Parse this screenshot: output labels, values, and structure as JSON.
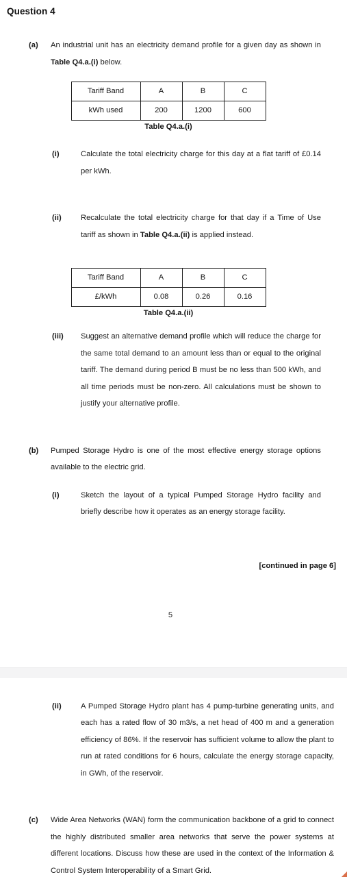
{
  "document": {
    "title": "Question 4",
    "page_number": "5",
    "continued_note": "[continued in page 6]"
  },
  "parts": {
    "a": {
      "marker": "(a)",
      "intro_prefix": "An industrial unit has an electricity demand profile for a given day as shown in ",
      "intro_bold": "Table Q4.a.(i)",
      "intro_suffix": " below.",
      "sub": {
        "i": {
          "marker": "(i)",
          "text": "Calculate the total electricity charge for this day at a flat tariff of £0.14 per kWh."
        },
        "ii": {
          "marker": "(ii)",
          "text_prefix": "Recalculate the total electricity charge for that day if a Time of Use tariff as shown in ",
          "text_bold": "Table Q4.a.(ii)",
          "text_suffix": " is applied instead."
        },
        "iii": {
          "marker": "(iii)",
          "text": "Suggest an alternative demand profile which will reduce the charge for the same total demand to an amount less than or equal to the original tariff. The demand during period B must be no less than 500 kWh, and all time periods must be non-zero. All calculations must be shown to justify your alternative profile."
        }
      }
    },
    "b": {
      "marker": "(b)",
      "intro": "Pumped Storage Hydro is one of the most effective energy storage options available to the electric grid.",
      "sub": {
        "i": {
          "marker": "(i)",
          "text": "Sketch the layout of a typical Pumped Storage Hydro facility and briefly describe how it operates as an energy storage facility."
        },
        "ii": {
          "marker": "(ii)",
          "text": "A Pumped Storage Hydro plant has 4 pump-turbine generating units, and each has a rated flow of 30 m3/s, a net head of 400 m and a generation efficiency of 86%.  If the reservoir has sufficient volume to allow the plant to run at rated conditions for 6 hours, calculate the energy storage capacity, in GWh, of the reservoir."
        }
      }
    },
    "c": {
      "marker": "(c)",
      "text": "Wide Area Networks (WAN) form the communication backbone of a grid to connect the highly distributed smaller area networks that serve the power systems at different locations. Discuss how these are used in the context of the Information & Control System Interoperability of a Smart Grid."
    }
  },
  "tables": {
    "demand": {
      "caption": "Table Q4.a.(i)",
      "rows": [
        {
          "label": "Tariff Band",
          "a": "A",
          "b": "B",
          "c": "C"
        },
        {
          "label": "kWh used",
          "a": "200",
          "b": "1200",
          "c": "600"
        }
      ]
    },
    "tariff": {
      "caption": "Table Q4.a.(ii)",
      "rows": [
        {
          "label": "Tariff Band",
          "a": "A",
          "b": "B",
          "c": "C"
        },
        {
          "label": "£/kWh",
          "a": "0.08",
          "b": "0.26",
          "c": "0.16"
        }
      ]
    }
  }
}
